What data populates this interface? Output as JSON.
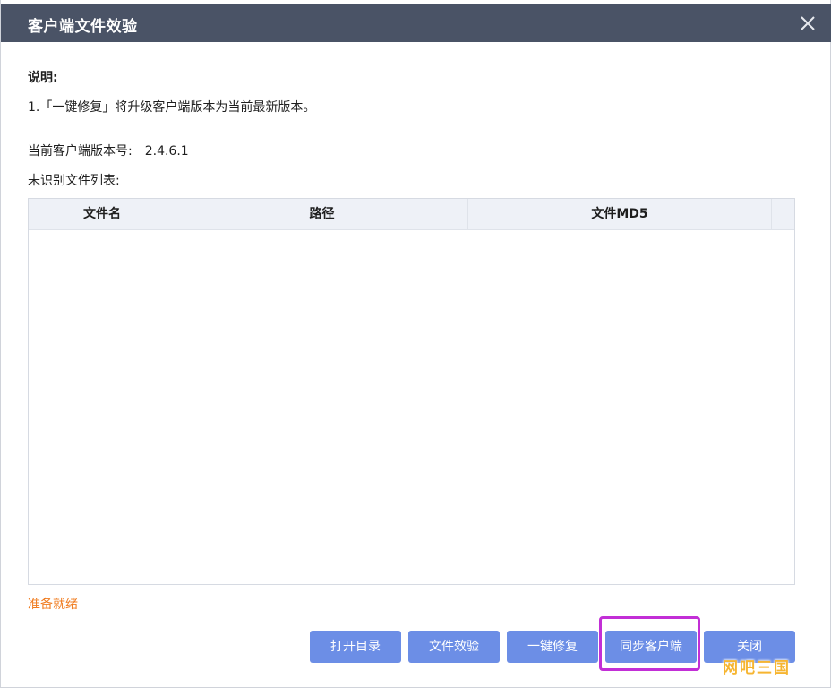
{
  "window": {
    "title": "客户端文件效验"
  },
  "description": {
    "label": "说明:",
    "line1": "1.「一键修复」将升级客户端版本为当前最新版本。"
  },
  "version": {
    "label": "当前客户端版本号:",
    "value": "2.4.6.1"
  },
  "file_list": {
    "caption": "未识别文件列表:",
    "columns": [
      "文件名",
      "路径",
      "文件MD5"
    ],
    "rows": []
  },
  "status": {
    "text": "准备就绪",
    "color": "#f07b1e"
  },
  "buttons": {
    "open_dir": "打开目录",
    "verify": "文件效验",
    "repair": "一键修复",
    "sync": "同步客户端",
    "close": "关闭"
  },
  "watermark": {
    "text": "网吧三国"
  },
  "colors": {
    "titlebar": "#4a5366",
    "button": "#6c8ee6",
    "highlight": "#c22fd6"
  },
  "icons": {
    "close": "close-icon"
  }
}
